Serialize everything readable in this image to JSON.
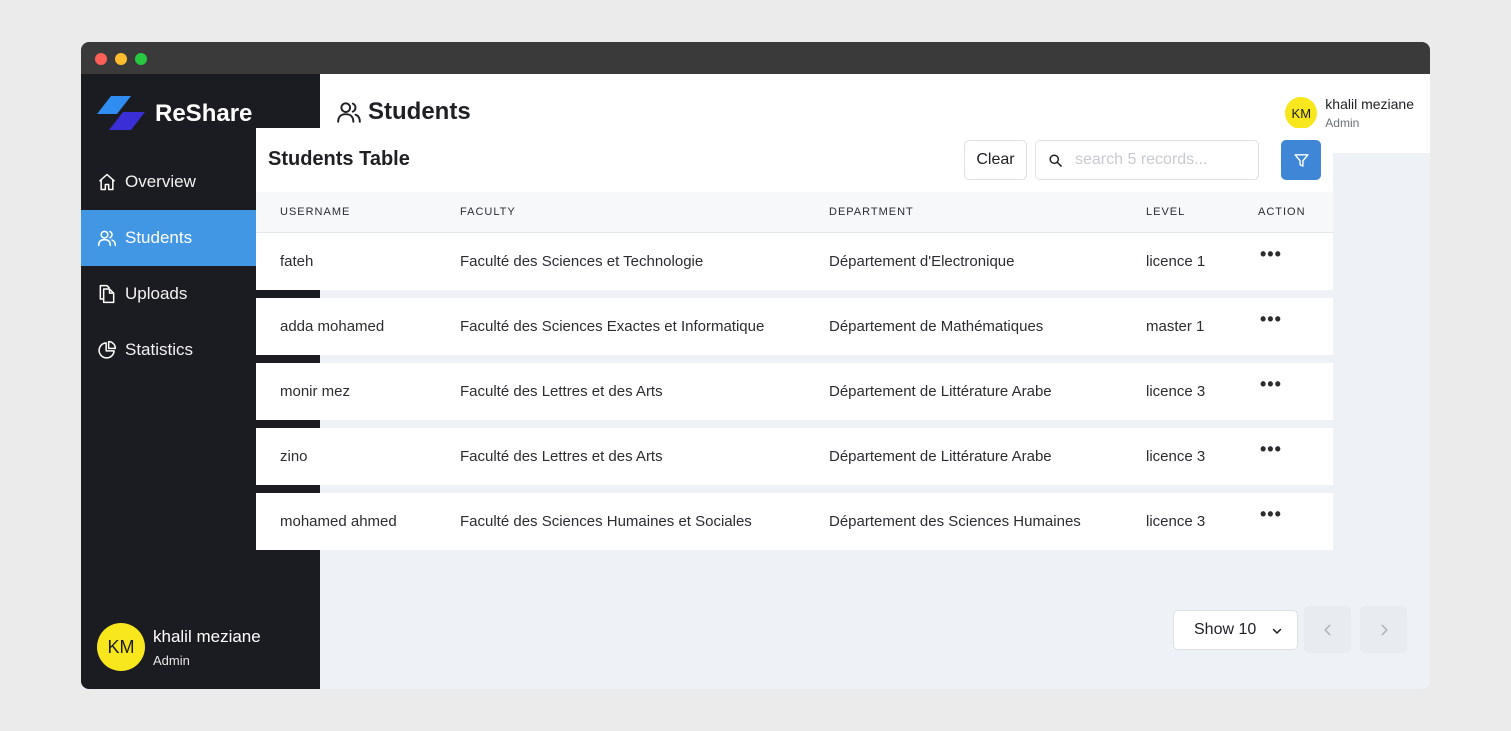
{
  "app": {
    "brand": "ReShare",
    "accent": "#4197e3"
  },
  "sidebar": {
    "items": [
      {
        "label": "Overview",
        "icon": "home-icon"
      },
      {
        "label": "Students",
        "icon": "users-icon",
        "active": true
      },
      {
        "label": "Uploads",
        "icon": "files-icon"
      },
      {
        "label": "Statistics",
        "icon": "pie-chart-icon"
      }
    ],
    "user": {
      "initials": "KM",
      "name": "khalil meziane",
      "role": "Admin"
    }
  },
  "header": {
    "title": "Students",
    "user": {
      "initials": "KM",
      "name": "khalil meziane",
      "role": "Admin"
    }
  },
  "table": {
    "title": "Students Table",
    "clear_label": "Clear",
    "search_placeholder": "search 5 records...",
    "columns": [
      "USERNAME",
      "FACULTY",
      "DEPARTMENT",
      "LEVEL",
      "ACTION"
    ],
    "rows": [
      {
        "username": "fateh",
        "faculty": "Faculté des Sciences et Technologie",
        "department": "Département d'Electronique",
        "level": "licence 1",
        "action": "•••"
      },
      {
        "username": "adda mohamed",
        "faculty": "Faculté des Sciences Exactes et Informatique",
        "department": "Département de Mathématiques",
        "level": "master 1",
        "action": "•••"
      },
      {
        "username": "monir mez",
        "faculty": "Faculté des Lettres et des Arts",
        "department": "Département de Littérature Arabe",
        "level": "licence 3",
        "action": "•••"
      },
      {
        "username": "zino",
        "faculty": "Faculté des Lettres et des Arts",
        "department": "Département de Littérature Arabe",
        "level": "licence 3",
        "action": "•••"
      },
      {
        "username": "mohamed ahmed",
        "faculty": "Faculté des Sciences Humaines et Sociales",
        "department": "Département des Sciences Humaines",
        "level": "licence 3",
        "action": "•••"
      }
    ]
  },
  "pagination": {
    "show_label": "Show 10"
  }
}
